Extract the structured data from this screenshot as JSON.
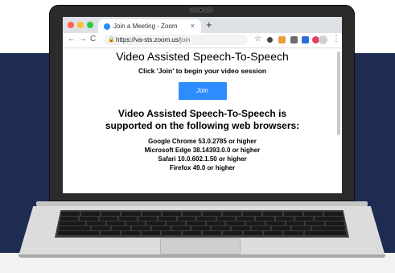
{
  "browser": {
    "tab_title": "Join a Meeting - Zoom",
    "tab_close": "×",
    "new_tab": "+",
    "url_host": "https://va-sts.zoom.us/",
    "url_path": "join",
    "nav_back": "←",
    "nav_forward": "→",
    "nav_reload": "C",
    "lock": "🔒",
    "star": "☆",
    "menu": "⋮"
  },
  "page": {
    "heading": "Video Assisted Speech-To-Speech",
    "instruction": "Click 'Join' to begin your video session",
    "join_label": "Join",
    "support_heading_line1": "Video Assisted Speech-To-Speech is",
    "support_heading_line2": "supported on the following web browsers:",
    "browsers": [
      "Google Chrome 53.0.2785 or higher",
      "Microsoft Edge 38.14393.0.0 or higher",
      "Safari 10.0.602.1.50 or higher",
      "Firefox 49.0 or higher"
    ]
  },
  "colors": {
    "accent": "#2d8cff",
    "background_band": "#1e2c52"
  }
}
